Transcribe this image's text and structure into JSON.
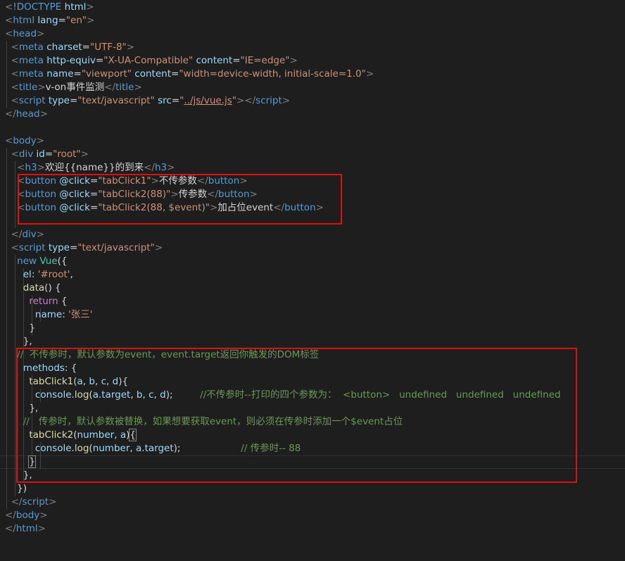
{
  "editor": {
    "lines": [
      [
        [
          "ang",
          "<"
        ],
        [
          "tag",
          "!DOCTYPE"
        ],
        [
          "attr",
          " html"
        ],
        [
          "ang",
          ">"
        ]
      ],
      [
        [
          "ang",
          "<"
        ],
        [
          "tag",
          "html"
        ],
        [
          "attr",
          " lang"
        ],
        [
          "text",
          "="
        ],
        [
          "str",
          "\"en\""
        ],
        [
          "ang",
          ">"
        ]
      ],
      [
        [
          "ang",
          "<"
        ],
        [
          "tag",
          "head"
        ],
        [
          "ang",
          ">"
        ]
      ],
      [
        [
          "text",
          "  "
        ],
        [
          "ang",
          "<"
        ],
        [
          "tag",
          "meta"
        ],
        [
          "attr",
          " charset"
        ],
        [
          "text",
          "="
        ],
        [
          "str",
          "\"UTF-8\""
        ],
        [
          "ang",
          ">"
        ]
      ],
      [
        [
          "text",
          "  "
        ],
        [
          "ang",
          "<"
        ],
        [
          "tag",
          "meta"
        ],
        [
          "attr",
          " http-equiv"
        ],
        [
          "text",
          "="
        ],
        [
          "str",
          "\"X-UA-Compatible\""
        ],
        [
          "attr",
          " content"
        ],
        [
          "text",
          "="
        ],
        [
          "str",
          "\"IE=edge\""
        ],
        [
          "ang",
          ">"
        ]
      ],
      [
        [
          "text",
          "  "
        ],
        [
          "ang",
          "<"
        ],
        [
          "tag",
          "meta"
        ],
        [
          "attr",
          " name"
        ],
        [
          "text",
          "="
        ],
        [
          "str",
          "\"viewport\""
        ],
        [
          "attr",
          " content"
        ],
        [
          "text",
          "="
        ],
        [
          "str",
          "\"width=device-width, initial-scale=1.0\""
        ],
        [
          "ang",
          ">"
        ]
      ],
      [
        [
          "text",
          "  "
        ],
        [
          "ang",
          "<"
        ],
        [
          "tag",
          "title"
        ],
        [
          "ang",
          ">"
        ],
        [
          "text",
          "v-on事件监测"
        ],
        [
          "ang",
          "</"
        ],
        [
          "tag",
          "title"
        ],
        [
          "ang",
          ">"
        ]
      ],
      [
        [
          "text",
          "  "
        ],
        [
          "ang",
          "<"
        ],
        [
          "tag",
          "script"
        ],
        [
          "attr",
          " type"
        ],
        [
          "text",
          "="
        ],
        [
          "str",
          "\"text/javascript\""
        ],
        [
          "attr",
          " src"
        ],
        [
          "text",
          "="
        ],
        [
          "str",
          "\""
        ],
        [
          "str-u",
          "../js/vue.js"
        ],
        [
          "str",
          "\""
        ],
        [
          "ang",
          "></"
        ],
        [
          "tag",
          "script"
        ],
        [
          "ang",
          ">"
        ]
      ],
      [
        [
          "ang",
          "</"
        ],
        [
          "tag",
          "head"
        ],
        [
          "ang",
          ">"
        ]
      ],
      [],
      [
        [
          "ang",
          "<"
        ],
        [
          "tag",
          "body"
        ],
        [
          "ang",
          ">"
        ]
      ],
      [
        [
          "text",
          "  "
        ],
        [
          "ang",
          "<"
        ],
        [
          "tag",
          "div"
        ],
        [
          "attr",
          " id"
        ],
        [
          "text",
          "="
        ],
        [
          "str",
          "\"root\""
        ],
        [
          "ang",
          ">"
        ]
      ],
      [
        [
          "text",
          "    "
        ],
        [
          "ang",
          "<"
        ],
        [
          "tag",
          "h3"
        ],
        [
          "ang",
          ">"
        ],
        [
          "text",
          "欢迎{{name}}的到来"
        ],
        [
          "ang",
          "</"
        ],
        [
          "tag",
          "h3"
        ],
        [
          "ang",
          ">"
        ]
      ],
      [
        [
          "text",
          "    "
        ],
        [
          "ang",
          "<"
        ],
        [
          "tag",
          "button"
        ],
        [
          "attr",
          " @click"
        ],
        [
          "text",
          "="
        ],
        [
          "str",
          "\"tabClick1\""
        ],
        [
          "ang",
          ">"
        ],
        [
          "text",
          "不传参数"
        ],
        [
          "ang",
          "</"
        ],
        [
          "tag",
          "button"
        ],
        [
          "ang",
          ">"
        ]
      ],
      [
        [
          "text",
          "    "
        ],
        [
          "ang",
          "<"
        ],
        [
          "tag",
          "button"
        ],
        [
          "attr",
          " @click"
        ],
        [
          "text",
          "="
        ],
        [
          "str",
          "\"tabClick2(88)\""
        ],
        [
          "ang",
          ">"
        ],
        [
          "text",
          "传参数"
        ],
        [
          "ang",
          "</"
        ],
        [
          "tag",
          "button"
        ],
        [
          "ang",
          ">"
        ]
      ],
      [
        [
          "text",
          "    "
        ],
        [
          "ang",
          "<"
        ],
        [
          "tag",
          "button"
        ],
        [
          "attr",
          " @click"
        ],
        [
          "text",
          "="
        ],
        [
          "str",
          "\"tabClick2(88, $event)\""
        ],
        [
          "ang",
          ">"
        ],
        [
          "text",
          "加占位event"
        ],
        [
          "ang",
          "</"
        ],
        [
          "tag",
          "button"
        ],
        [
          "ang",
          ">"
        ]
      ],
      [],
      [
        [
          "text",
          "  "
        ],
        [
          "ang",
          "</"
        ],
        [
          "tag",
          "div"
        ],
        [
          "ang",
          ">"
        ]
      ],
      [
        [
          "text",
          "  "
        ],
        [
          "ang",
          "<"
        ],
        [
          "tag",
          "script"
        ],
        [
          "attr",
          " type"
        ],
        [
          "text",
          "="
        ],
        [
          "str",
          "\"text/javascript\""
        ],
        [
          "ang",
          ">"
        ]
      ],
      [
        [
          "text",
          "    "
        ],
        [
          "new",
          "new"
        ],
        [
          "text",
          " "
        ],
        [
          "cls",
          "Vue"
        ],
        [
          "text",
          "({"
        ]
      ],
      [
        [
          "text",
          "      "
        ],
        [
          "var",
          "el"
        ],
        [
          "text",
          ": "
        ],
        [
          "str",
          "'#root'"
        ],
        [
          "text",
          ","
        ]
      ],
      [
        [
          "text",
          "      "
        ],
        [
          "fn",
          "data"
        ],
        [
          "text",
          "() {"
        ]
      ],
      [
        [
          "text",
          "        "
        ],
        [
          "kw",
          "return"
        ],
        [
          "text",
          " {"
        ]
      ],
      [
        [
          "text",
          "          "
        ],
        [
          "var",
          "name"
        ],
        [
          "text",
          ": "
        ],
        [
          "str",
          "'张三'"
        ]
      ],
      [
        [
          "text",
          "        }"
        ]
      ],
      [
        [
          "text",
          "      },"
        ]
      ],
      [
        [
          "text",
          "    "
        ],
        [
          "com",
          "//  不传参时，默认参数为event，event.target返回你触发的DOM标签"
        ]
      ],
      [
        [
          "text",
          "      "
        ],
        [
          "var",
          "methods"
        ],
        [
          "text",
          ": {"
        ]
      ],
      [
        [
          "text",
          "        "
        ],
        [
          "fn",
          "tabClick1"
        ],
        [
          "text",
          "("
        ],
        [
          "var",
          "a"
        ],
        [
          "text",
          ", "
        ],
        [
          "var",
          "b"
        ],
        [
          "text",
          ", "
        ],
        [
          "var",
          "c"
        ],
        [
          "text",
          ", "
        ],
        [
          "var",
          "d"
        ],
        [
          "text",
          "){"
        ]
      ],
      [
        [
          "text",
          "          "
        ],
        [
          "var",
          "console"
        ],
        [
          "text",
          "."
        ],
        [
          "fn",
          "log"
        ],
        [
          "text",
          "("
        ],
        [
          "var",
          "a"
        ],
        [
          "text",
          "."
        ],
        [
          "var",
          "target"
        ],
        [
          "text",
          ", "
        ],
        [
          "var",
          "b"
        ],
        [
          "text",
          ", "
        ],
        [
          "var",
          "c"
        ],
        [
          "text",
          ", "
        ],
        [
          "var",
          "d"
        ],
        [
          "text",
          ");         "
        ],
        [
          "com",
          "//不传参时--打印的四个参数为：  <button>   undefined   undefined   undefined"
        ]
      ],
      [
        [
          "text",
          "        },"
        ]
      ],
      [
        [
          "text",
          "      "
        ],
        [
          "com",
          "//   传参时，默认参数被替换，如果想要获取event，则必须在传参时添加一个$event占位"
        ]
      ],
      [
        [
          "text",
          "        "
        ],
        [
          "fn",
          "tabClick2"
        ],
        [
          "text",
          "("
        ],
        [
          "var",
          "number"
        ],
        [
          "text",
          ", "
        ],
        [
          "var",
          "a"
        ],
        [
          "text",
          ")"
        ],
        [
          "brk",
          "{"
        ]
      ],
      [
        [
          "text",
          "          "
        ],
        [
          "var",
          "console"
        ],
        [
          "text",
          "."
        ],
        [
          "fn",
          "log"
        ],
        [
          "text",
          "("
        ],
        [
          "var",
          "number"
        ],
        [
          "text",
          ", "
        ],
        [
          "var",
          "a"
        ],
        [
          "text",
          "."
        ],
        [
          "var",
          "target"
        ],
        [
          "text",
          ");                    "
        ],
        [
          "com",
          "// 传参时-- 88"
        ]
      ],
      [
        [
          "text",
          "        "
        ],
        [
          "brk",
          "}"
        ]
      ],
      [
        [
          "text",
          "      },"
        ]
      ],
      [
        [
          "text",
          "    })"
        ]
      ],
      [
        [
          "text",
          "  "
        ],
        [
          "ang",
          "</"
        ],
        [
          "tag",
          "script"
        ],
        [
          "ang",
          ">"
        ]
      ],
      [
        [
          "ang",
          "</"
        ],
        [
          "tag",
          "body"
        ],
        [
          "ang",
          ">"
        ]
      ],
      [
        [
          "ang",
          "</"
        ],
        [
          "tag",
          "html"
        ],
        [
          "ang",
          ">"
        ]
      ]
    ]
  },
  "colors": {
    "background": "#1e1e1e",
    "highlight_box": "#e01010"
  }
}
